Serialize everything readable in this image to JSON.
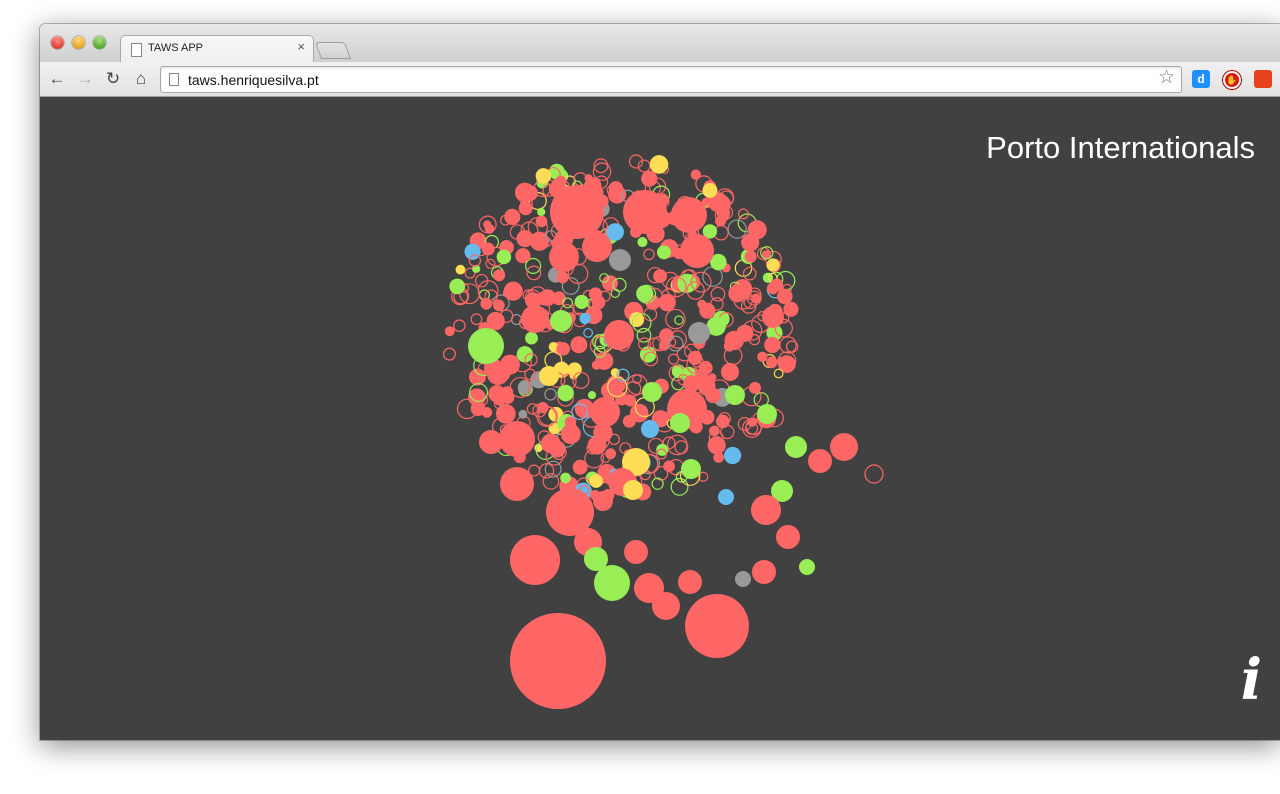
{
  "browser": {
    "tab_title": "TAWS APP",
    "tab_close": "×",
    "url": "taws.henriquesilva.pt",
    "nav": {
      "back": "←",
      "forward": "→",
      "reload": "↻",
      "home": "⌂",
      "bookmark_star": "☆"
    },
    "extensions": [
      {
        "name": "d-extension-icon",
        "glyph": "d"
      },
      {
        "name": "adblock-icon",
        "glyph": "✋"
      },
      {
        "name": "bookmark-extension-icon",
        "glyph": ""
      }
    ]
  },
  "page": {
    "title": "Porto Internationals",
    "info_glyph": "i"
  },
  "colors": {
    "background": "#414141",
    "red": "#ff6666",
    "green": "#99ee55",
    "yellow": "#ffdd55",
    "gray": "#999999",
    "blue": "#66bbee"
  },
  "legend_note": ""
}
